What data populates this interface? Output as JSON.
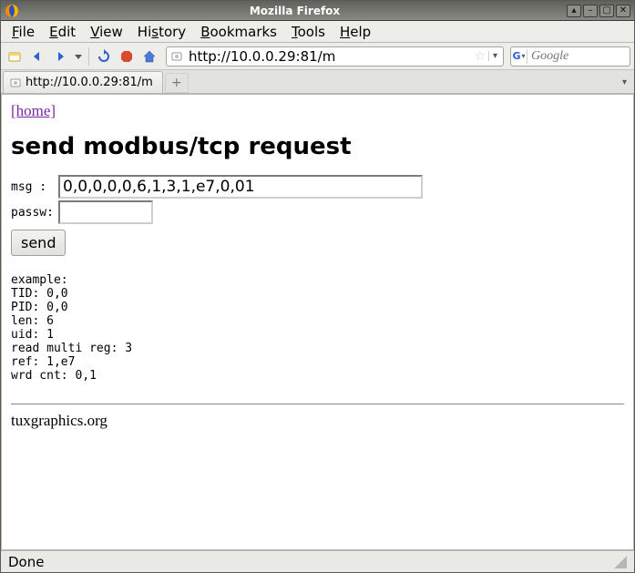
{
  "titlebar": {
    "title": "Mozilla Firefox"
  },
  "menu": {
    "file": "File",
    "edit": "Edit",
    "view": "View",
    "history": "History",
    "bookmarks": "Bookmarks",
    "tools": "Tools",
    "help": "Help"
  },
  "nav": {
    "url": "http://10.0.0.29:81/m",
    "search_placeholder": "Google"
  },
  "tabs": {
    "active_label": "http://10.0.0.29:81/m"
  },
  "page": {
    "home_link": "[home]",
    "heading": "send modbus/tcp request",
    "form": {
      "msg_label": "msg  :",
      "msg_value": "0,0,0,0,0,6,1,3,1,e7,0,01",
      "passw_label": "passw:",
      "passw_value": "",
      "send_label": "send"
    },
    "example_block": "example:\nTID: 0,0\nPID: 0,0\nlen: 6\nuid: 1\nread multi reg: 3\nref: 1,e7\nwrd cnt: 0,1",
    "footer": "tuxgraphics.org"
  },
  "status": {
    "text": "Done"
  }
}
